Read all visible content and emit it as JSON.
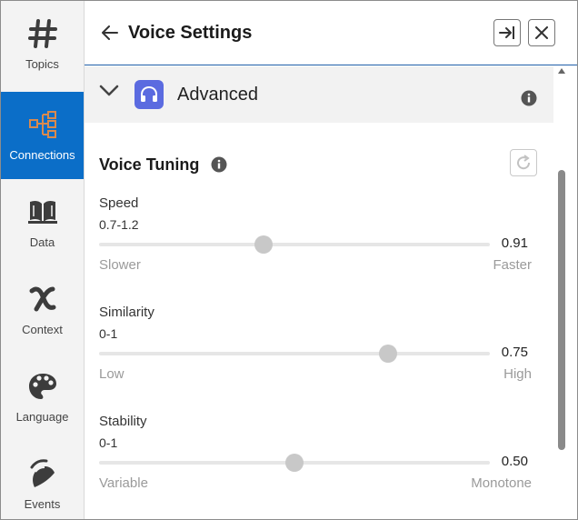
{
  "sidebar": {
    "items": [
      {
        "label": "Topics",
        "icon": "hash-icon"
      },
      {
        "label": "Connections",
        "icon": "hierarchy-icon",
        "active": true
      },
      {
        "label": "Data",
        "icon": "book-icon"
      },
      {
        "label": "Context",
        "icon": "variable-x-icon"
      },
      {
        "label": "Language",
        "icon": "palette-icon"
      },
      {
        "label": "Events",
        "icon": "signal-icon"
      }
    ]
  },
  "header": {
    "title": "Voice Settings"
  },
  "section": {
    "label": "Advanced"
  },
  "voice_tuning": {
    "title": "Voice Tuning",
    "params": [
      {
        "name": "Speed",
        "range": "0.7-1.2",
        "value": "0.91",
        "fraction": 0.42,
        "min_label": "Slower",
        "max_label": "Faster"
      },
      {
        "name": "Similarity",
        "range": "0-1",
        "value": "0.75",
        "fraction": 0.74,
        "min_label": "Low",
        "max_label": "High"
      },
      {
        "name": "Stability",
        "range": "0-1",
        "value": "0.50",
        "fraction": 0.5,
        "min_label": "Variable",
        "max_label": "Monotone"
      }
    ]
  },
  "colors": {
    "accent": "#0b6ec8",
    "section_icon_bg": "#5b6be0"
  }
}
